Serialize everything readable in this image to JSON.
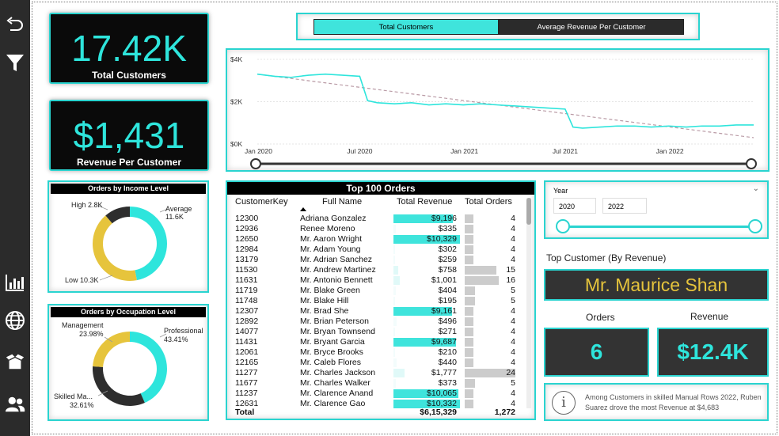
{
  "sidebar": {
    "icons": [
      "back-arrow-icon",
      "filter-icon",
      "bar-chart-icon",
      "globe-icon",
      "box-icon",
      "users-icon"
    ]
  },
  "kpis": {
    "total_customers_value": "17.42K",
    "total_customers_label": "Total Customers",
    "revenue_per_customer_value": "$1,431",
    "revenue_per_customer_label": "Revenue Per Customer"
  },
  "toggle": {
    "option1": "Total Customers",
    "option2": "Average Revenue Per Customer",
    "selected": "Total Customers"
  },
  "income_chart": {
    "title": "Orders by Income Level",
    "high_label": "High 2.8K",
    "average_label": "Average",
    "average_value": "11.6K",
    "low_label": "Low 10.3K"
  },
  "occupation_chart": {
    "title": "Orders by Occupation Level",
    "management_label": "Management",
    "management_pct": "23.98%",
    "professional_label": "Professional",
    "professional_pct": "43.41%",
    "skilled_label": "Skilled Ma...",
    "skilled_pct": "32.61%"
  },
  "table": {
    "title": "Top 100 Orders",
    "columns": [
      "CustomerKey",
      "Full Name",
      "Total Revenue",
      "Total Orders"
    ],
    "rows": [
      [
        "12300",
        "Adriana Gonzalez",
        "$9,196",
        "4"
      ],
      [
        "12936",
        "Renee Moreno",
        "$335",
        "4"
      ],
      [
        "12650",
        "Mr. Aaron Wright",
        "$10,329",
        "4"
      ],
      [
        "12984",
        "Mr. Adam Young",
        "$302",
        "4"
      ],
      [
        "13179",
        "Mr. Adrian Sanchez",
        "$259",
        "4"
      ],
      [
        "11530",
        "Mr. Andrew Martinez",
        "$758",
        "15"
      ],
      [
        "11631",
        "Mr. Antonio Bennett",
        "$1,001",
        "16"
      ],
      [
        "11719",
        "Mr. Blake Green",
        "$404",
        "5"
      ],
      [
        "11748",
        "Mr. Blake Hill",
        "$195",
        "5"
      ],
      [
        "12307",
        "Mr. Brad She",
        "$9,161",
        "4"
      ],
      [
        "12892",
        "Mr. Brian Peterson",
        "$496",
        "4"
      ],
      [
        "14077",
        "Mr. Bryan Townsend",
        "$271",
        "4"
      ],
      [
        "11431",
        "Mr. Bryant Garcia",
        "$9,687",
        "4"
      ],
      [
        "12061",
        "Mr. Bryce Brooks",
        "$210",
        "4"
      ],
      [
        "12165",
        "Mr. Caleb Flores",
        "$440",
        "4"
      ],
      [
        "11277",
        "Mr. Charles Jackson",
        "$1,777",
        "24"
      ],
      [
        "11677",
        "Mr. Charles Walker",
        "$373",
        "5"
      ],
      [
        "11237",
        "Mr. Clarence Anand",
        "$10,065",
        "4"
      ],
      [
        "12631",
        "Mr. Clarence Gao",
        "$10,332",
        "4"
      ]
    ],
    "total_label": "Total",
    "total_revenue": "$6,15,329",
    "total_orders": "1,272"
  },
  "year_slicer": {
    "label": "Year",
    "from": "2020",
    "to": "2022"
  },
  "top_customer": {
    "heading": "Top Customer (By Revenue)",
    "name": "Mr. Maurice Shan",
    "orders_label": "Orders",
    "orders_value": "6",
    "revenue_label": "Revenue",
    "revenue_value": "$12.4K"
  },
  "insight": {
    "text": "Among Customers in skilled Manual Rows 2022, Ruben Suarez drove the most Revenue at $4,683"
  },
  "chart_data": {
    "type": "line",
    "y_ticks": [
      "$4K",
      "$2K",
      "$0K"
    ],
    "x_ticks": [
      "Jan 2020",
      "Jul 2020",
      "Jan 2021",
      "Jul 2021",
      "Jan 2022"
    ],
    "ylim": [
      0,
      4000
    ],
    "xlim": [
      "2020-01",
      "2022-06"
    ],
    "series": [
      {
        "color": "#2ee5dc",
        "points": [
          [
            "2020-01-01",
            3300
          ],
          [
            "2020-02-01",
            3200
          ],
          [
            "2020-03-01",
            3150
          ],
          [
            "2020-04-01",
            3250
          ],
          [
            "2020-05-01",
            3300
          ],
          [
            "2020-06-01",
            3250
          ],
          [
            "2020-07-01",
            3200
          ],
          [
            "2020-07-15",
            2050
          ],
          [
            "2020-08-01",
            1950
          ],
          [
            "2020-09-01",
            1900
          ],
          [
            "2020-10-01",
            1950
          ],
          [
            "2020-11-01",
            1850
          ],
          [
            "2020-12-01",
            1900
          ],
          [
            "2021-01-01",
            1850
          ],
          [
            "2021-02-01",
            1900
          ],
          [
            "2021-03-01",
            1850
          ],
          [
            "2021-04-01",
            1800
          ],
          [
            "2021-05-01",
            1750
          ],
          [
            "2021-06-01",
            1700
          ],
          [
            "2021-07-01",
            1650
          ],
          [
            "2021-07-15",
            800
          ],
          [
            "2021-08-01",
            750
          ],
          [
            "2021-09-01",
            800
          ],
          [
            "2021-10-01",
            850
          ],
          [
            "2021-11-01",
            850
          ],
          [
            "2021-12-01",
            800
          ],
          [
            "2022-01-01",
            850
          ],
          [
            "2022-02-01",
            800
          ],
          [
            "2022-03-01",
            850
          ],
          [
            "2022-04-01",
            850
          ],
          [
            "2022-05-01",
            900
          ],
          [
            "2022-06-01",
            900
          ]
        ]
      }
    ],
    "trendline": {
      "color": "#b99aa5",
      "from": [
        "2020-01-01",
        3300
      ],
      "to": [
        "2022-06-01",
        300
      ]
    },
    "grid": true
  }
}
